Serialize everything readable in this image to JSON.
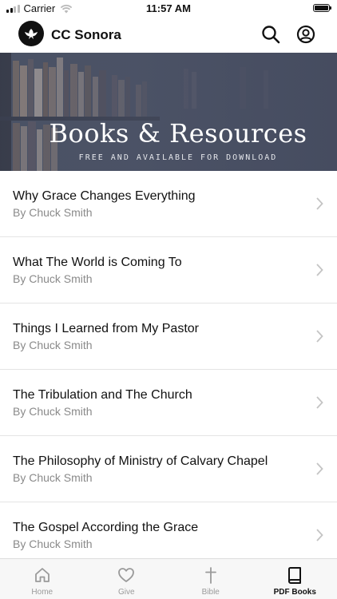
{
  "status_bar": {
    "carrier": "Carrier",
    "time": "11:57 AM"
  },
  "header": {
    "app_name": "CC Sonora",
    "logo_icon": "dove-icon",
    "search_icon": "search-icon",
    "account_icon": "user-circle-icon"
  },
  "banner": {
    "title": "Books & Resources",
    "subtitle": "FREE AND AVAILABLE FOR DOWNLOAD"
  },
  "books": [
    {
      "title": "Why Grace Changes Everything",
      "author": "By Chuck Smith"
    },
    {
      "title": "What The World is Coming To",
      "author": "By Chuck Smith"
    },
    {
      "title": "Things I Learned from My Pastor",
      "author": "By Chuck Smith"
    },
    {
      "title": "The Tribulation and The Church",
      "author": "By Chuck Smith"
    },
    {
      "title": "The Philosophy of Ministry of Calvary Chapel",
      "author": "By Chuck Smith"
    },
    {
      "title": "The Gospel According the Grace",
      "author": "By Chuck Smith"
    }
  ],
  "tabs": [
    {
      "label": "Home",
      "icon": "home-icon",
      "active": false
    },
    {
      "label": "Give",
      "icon": "heart-icon",
      "active": false
    },
    {
      "label": "Bible",
      "icon": "cross-icon",
      "active": false
    },
    {
      "label": "PDF Books",
      "icon": "book-icon",
      "active": true
    }
  ],
  "colors": {
    "text": "#111111",
    "secondary_text": "#8a8a8a",
    "tab_inactive": "#9a9a9a",
    "divider": "#e4e4e4"
  }
}
